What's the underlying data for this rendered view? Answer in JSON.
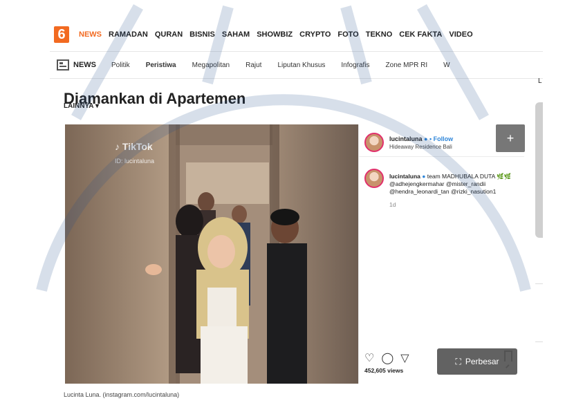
{
  "logo": {
    "text": "6"
  },
  "top_nav": [
    "NEWS",
    "RAMADAN",
    "QURAN",
    "BISNIS",
    "SAHAM",
    "SHOWBIZ",
    "CRYPTO",
    "FOTO",
    "TEKNO",
    "CEK FAKTA",
    "VIDEO"
  ],
  "sub_nav": {
    "label": "NEWS",
    "items": [
      "Politik",
      "Peristiwa",
      "Megapolitan",
      "Rajut",
      "Liputan Khusus",
      "Infografis",
      "Zone MPR RI",
      "W"
    ]
  },
  "lainnya": "LAINNYA",
  "headline": "Diamankan di Apartemen",
  "video": {
    "platform": "TikTok",
    "handle": "ID: lucintaluna"
  },
  "instagram": {
    "username": "lucintaluna",
    "follow": "Follow",
    "location": "Hideaway Residence Bali",
    "caption_user": "lucintaluna",
    "caption_text": "team MADHUBALA DUTA 🌿🌿 @adhejengkermahar @mister_randii @hendra_leonardi_tan @rizki_nasution1",
    "time": "1d",
    "views": "452,605 views"
  },
  "enlarge_button": "Perbesar",
  "photo_caption": "Lucinta Luna. (instagram.com/lucintaluna)",
  "colors": {
    "brand": "#f26a21",
    "follow_blue": "#2f86d9"
  }
}
